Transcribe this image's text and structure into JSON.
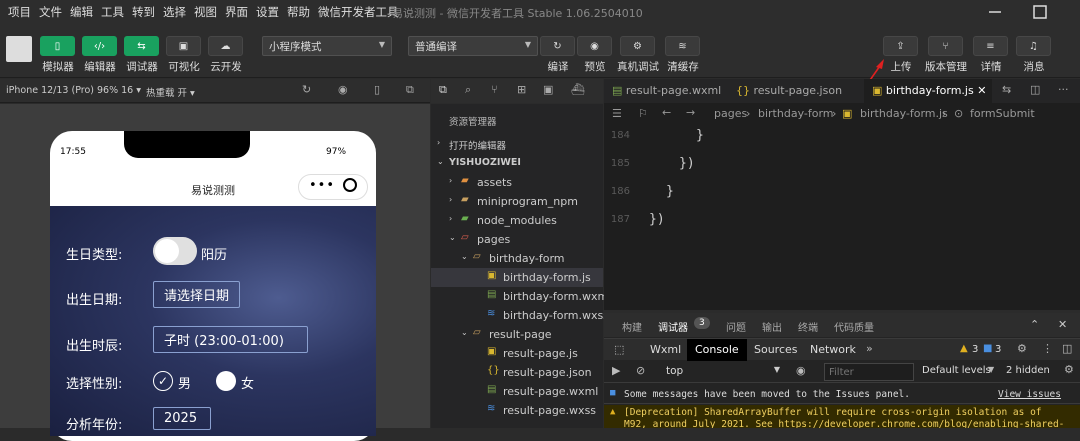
{
  "menu": [
    "项目",
    "文件",
    "编辑",
    "工具",
    "转到",
    "选择",
    "视图",
    "界面",
    "设置",
    "帮助",
    "微信开发者工具"
  ],
  "window_title": "易说测测 - 微信开发者工具 Stable 1.06.2504010",
  "toolbar": {
    "left_buttons": [
      "模拟器",
      "编辑器",
      "调试器",
      "可视化",
      "云开发"
    ],
    "mode_select": "小程序模式",
    "compile_select": "普通编译",
    "mid_buttons": [
      "编译",
      "预览",
      "真机调试",
      "清缓存"
    ],
    "right_buttons": [
      "上传",
      "版本管理",
      "详情",
      "消息"
    ]
  },
  "sim_bar": {
    "device": "iPhone 12/13 (Pro) 96% 16 ▾",
    "hotreload": "热重载 开 ▾"
  },
  "phone": {
    "time": "17:55",
    "battery": "97%",
    "title": "易说测测",
    "fields": {
      "birth_type_label": "生日类型:",
      "birth_type_value": "阳历",
      "birth_date_label": "出生日期:",
      "birth_date_value": "请选择日期",
      "birth_hour_label": "出生时辰:",
      "birth_hour_value": "子时 (23:00-01:00)",
      "gender_label": "选择性别:",
      "male": "男",
      "female": "女",
      "year_label": "分析年份:",
      "year_value": "2025"
    }
  },
  "explorer": {
    "header": "资源管理器",
    "open_editors": "打开的编辑器",
    "project": "YISHUOZIWEI",
    "tree": [
      {
        "name": "assets",
        "depth": 1,
        "type": "folder"
      },
      {
        "name": "miniprogram_npm",
        "depth": 1,
        "type": "folder"
      },
      {
        "name": "node_modules",
        "depth": 1,
        "type": "folder"
      },
      {
        "name": "pages",
        "depth": 1,
        "type": "folder-open"
      },
      {
        "name": "birthday-form",
        "depth": 2,
        "type": "folder-open"
      },
      {
        "name": "birthday-form.js",
        "depth": 3,
        "type": "js"
      },
      {
        "name": "birthday-form.wxml",
        "depth": 3,
        "type": "wxml"
      },
      {
        "name": "birthday-form.wxss",
        "depth": 3,
        "type": "wxss"
      },
      {
        "name": "result-page",
        "depth": 2,
        "type": "folder-open"
      },
      {
        "name": "result-page.js",
        "depth": 3,
        "type": "js"
      },
      {
        "name": "result-page.json",
        "depth": 3,
        "type": "json"
      },
      {
        "name": "result-page.wxml",
        "depth": 3,
        "type": "wxml"
      },
      {
        "name": "result-page.wxss",
        "depth": 3,
        "type": "wxss"
      }
    ]
  },
  "editor": {
    "tabs": [
      "result-page.wxml",
      "result-page.json",
      "birthday-form.js"
    ],
    "breadcrumb": [
      "pages",
      "birthday-form",
      "birthday-form.js",
      "formSubmit"
    ],
    "lines": [
      {
        "num": "184",
        "text": "}"
      },
      {
        "num": "185",
        "text": "})"
      },
      {
        "num": "186",
        "text": "}"
      },
      {
        "num": "187",
        "text": "})"
      }
    ]
  },
  "devtools": {
    "tabs": [
      "构建",
      "调试器",
      "问题",
      "输出",
      "终端",
      "代码质量"
    ],
    "debugger_badge": "3",
    "console_tabs": [
      "Wxml",
      "Console",
      "Sources",
      "Network"
    ],
    "warn_count": "3",
    "info_count": "3",
    "context": "top",
    "filter_placeholder": "Filter",
    "levels": "Default levels",
    "hidden": "2 hidden",
    "messages": [
      {
        "text": "Some messages have been moved to the Issues panel.",
        "link": "View issues",
        "level": "info"
      },
      {
        "text": "[Deprecation] SharedArrayBuffer will require cross-origin isolation as of",
        "level": "warn"
      },
      {
        "text": "M92, around July 2021. See https://developer.chrome.com/blog/enabling-shared-",
        "level": "warn"
      }
    ]
  }
}
